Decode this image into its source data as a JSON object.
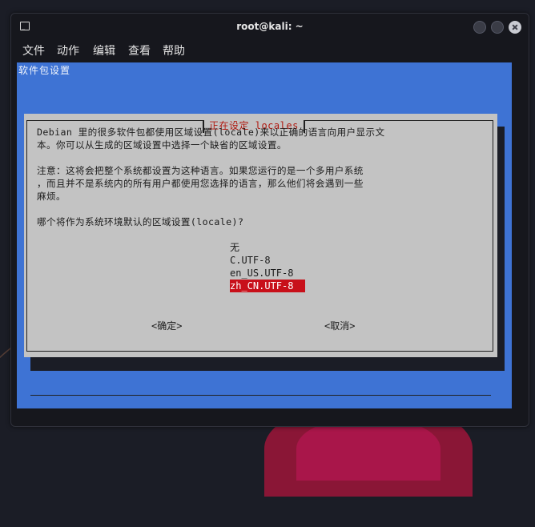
{
  "window": {
    "title": "root@kali: ~"
  },
  "menubar": [
    "文件",
    "动作",
    "编辑",
    "查看",
    "帮助"
  ],
  "backtitle": "软件包设置",
  "dialog": {
    "title": "正在设定 locales",
    "lines": [
      "Debian 里的很多软件包都使用区域设置(locale)来以正确的语言向用户显示文",
      "本。你可以从生成的区域设置中选择一个缺省的区域设置。",
      "注意：这将会把整个系统都设置为这种语言。如果您运行的是一个多用户系统",
      "，而且并不是系统内的所有用户都使用您选择的语言，那么他们将会遇到一些",
      "麻烦。",
      "哪个将作为系统环境默认的区域设置(locale)?"
    ],
    "options": [
      "无",
      "C.UTF-8",
      "en_US.UTF-8",
      "zh_CN.UTF-8"
    ],
    "selected_option": "zh_CN.UTF-8",
    "ok_button": "<确定>",
    "cancel_button": "<取消>"
  },
  "colors": {
    "terminal_bg": "#3e73d4",
    "dialog_bg": "#c3c3c3",
    "title_text": "#b0180f",
    "selection_bg": "#c8101a"
  }
}
